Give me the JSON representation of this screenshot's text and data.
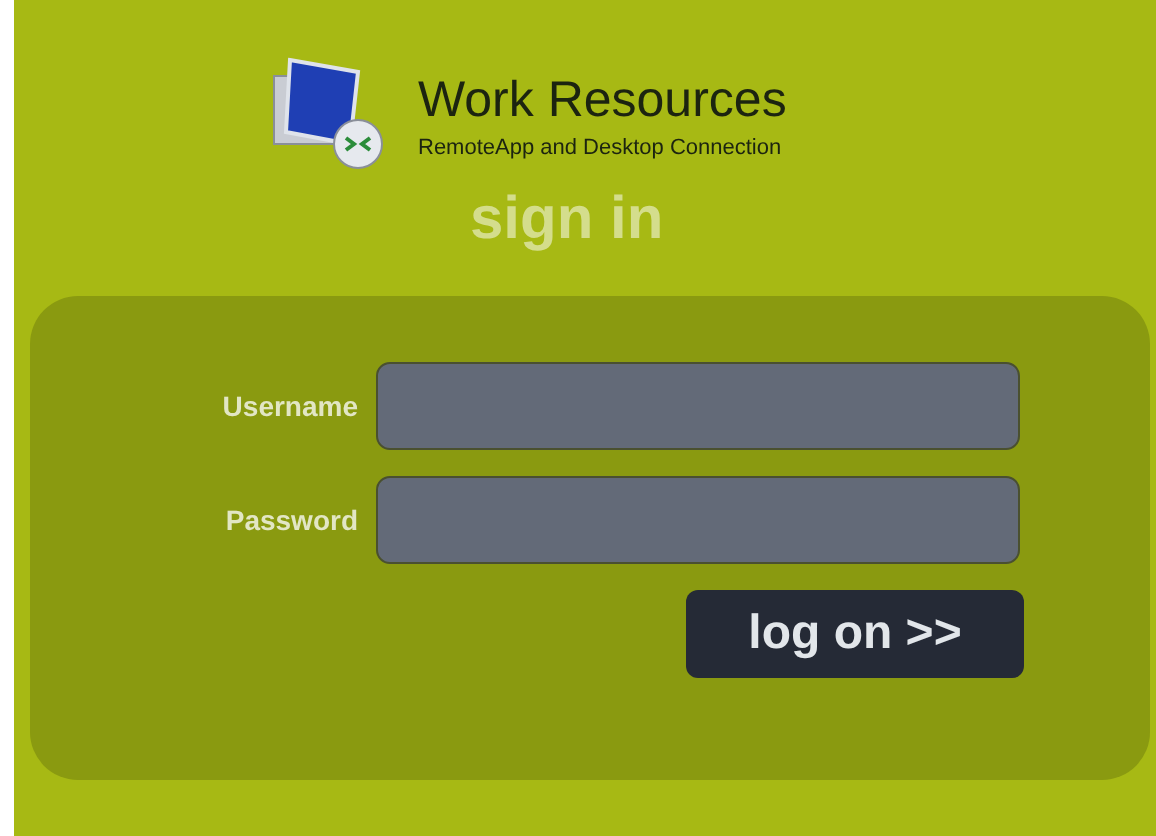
{
  "header": {
    "title": "Work Resources",
    "subtitle": "RemoteApp and Desktop Connection"
  },
  "heading": "sign in",
  "form": {
    "fields": [
      {
        "label": "Username"
      },
      {
        "label": "Password"
      }
    ],
    "submit": "log on >>"
  }
}
